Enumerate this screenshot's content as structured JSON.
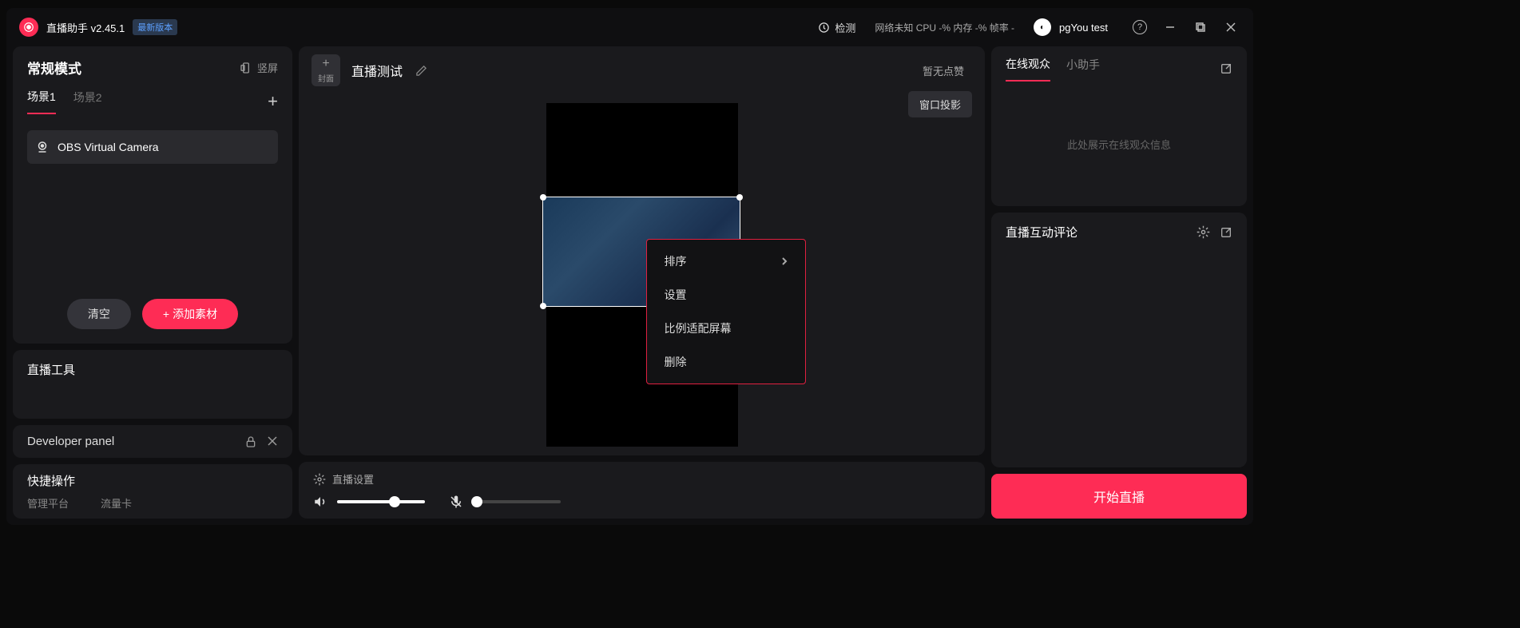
{
  "titlebar": {
    "app_name": "直播助手 v2.45.1",
    "version_badge": "最新版本",
    "detect_label": "检测",
    "stats": "网络未知  CPU -%  内存 -%  帧率 -",
    "username": "pgYou test"
  },
  "left": {
    "mode_title": "常规模式",
    "portrait_label": "竖屏",
    "scene_tabs": [
      "场景1",
      "场景2"
    ],
    "source_name": "OBS Virtual Camera",
    "clear_btn": "清空",
    "add_source_btn": "添加素材",
    "tools_title": "直播工具",
    "dev_panel_label": "Developer panel",
    "quick_title": "快捷操作",
    "quick_items": [
      "管理平台",
      "流量卡"
    ]
  },
  "center": {
    "cover_label": "封面",
    "stream_title": "直播测试",
    "no_likes": "暂无点赞",
    "window_proj": "窗口投影",
    "settings_label": "直播设置",
    "context_menu": [
      "排序",
      "设置",
      "比例适配屏幕",
      "删除"
    ]
  },
  "right": {
    "audience_tabs": [
      "在线观众",
      "小助手"
    ],
    "audience_placeholder": "此处展示在线观众信息",
    "comment_title": "直播互动评论",
    "start_btn": "开始直播"
  }
}
